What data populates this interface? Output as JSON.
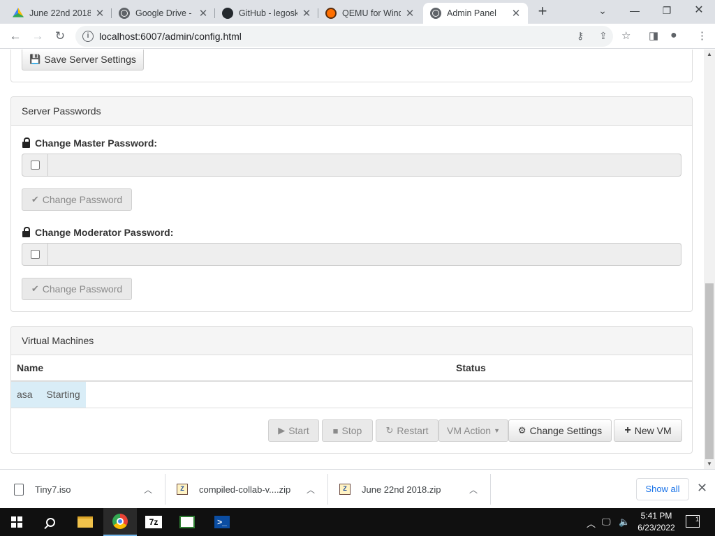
{
  "browser": {
    "tabs": [
      {
        "title": "June 22nd 2018",
        "icon": "google-drive-icon"
      },
      {
        "title": "Google Drive - ",
        "icon": "globe-icon"
      },
      {
        "title": "GitHub - legosk",
        "icon": "github-icon"
      },
      {
        "title": "QEMU for Wind",
        "icon": "qemu-icon"
      },
      {
        "title": "Admin Panel",
        "icon": "globe-icon",
        "active": true
      }
    ],
    "url": "localhost:6007/admin/config.html"
  },
  "page": {
    "save_server_settings": "Save Server Settings",
    "passwords": {
      "heading": "Server Passwords",
      "master_label": "Change Master Password:",
      "moderator_label": "Change Moderator Password:",
      "change_button": "Change Password"
    },
    "vms": {
      "heading": "Virtual Machines",
      "columns": [
        "Name",
        "Status"
      ],
      "rows": [
        {
          "name": "asa",
          "status": "Starting"
        }
      ],
      "actions": {
        "start": "Start",
        "stop": "Stop",
        "restart": "Restart",
        "vm_action": "VM Action",
        "change_settings": "Change Settings",
        "new_vm": "New VM"
      }
    }
  },
  "downloads": {
    "items": [
      "Tiny7.iso",
      "compiled-collab-v....zip",
      "June 22nd 2018.zip"
    ],
    "show_all": "Show all"
  },
  "taskbar": {
    "clock_time": "5:41 PM",
    "clock_date": "6/23/2022",
    "notification_count": "1"
  },
  "colors": {
    "selected_row": "#d9edf7",
    "panel_heading": "#f5f5f5",
    "taskbar": "#101010"
  }
}
